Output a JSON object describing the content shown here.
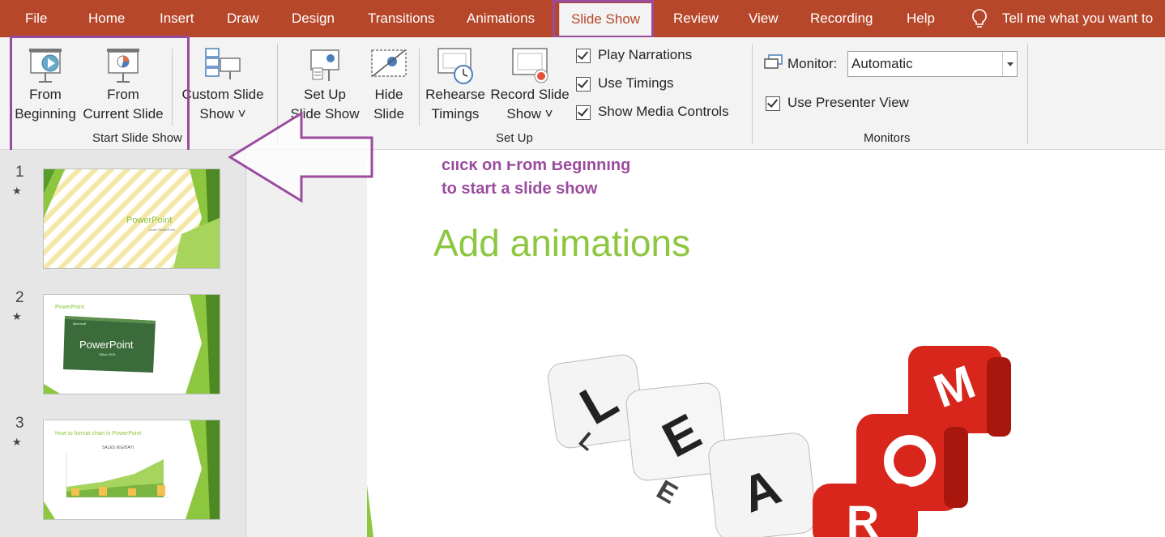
{
  "tabs": [
    "File",
    "Home",
    "Insert",
    "Draw",
    "Design",
    "Transitions",
    "Animations",
    "Slide Show",
    "Review",
    "View",
    "Recording",
    "Help"
  ],
  "tell_me": "Tell me what you want to",
  "ribbon": {
    "from_beginning": [
      "From",
      "Beginning"
    ],
    "from_current": [
      "From",
      "Current Slide"
    ],
    "custom_show": [
      "Custom Slide",
      "Show ˅"
    ],
    "start_group": "Start Slide Show",
    "setup_show": [
      "Set Up",
      "Slide Show"
    ],
    "hide_slide": [
      "Hide",
      "Slide"
    ],
    "rehearse": [
      "Rehearse",
      "Timings"
    ],
    "record": [
      "Record Slide",
      "Show ˅"
    ],
    "play_narrations": "Play Narrations",
    "use_timings": "Use Timings",
    "show_media": "Show Media Controls",
    "setup_group": "Set Up",
    "monitor_label": "Monitor:",
    "monitor_value": "Automatic",
    "presenter_view": "Use Presenter View",
    "monitors_group": "Monitors"
  },
  "slides": [
    {
      "num": "1",
      "thumb_title": "PowerPoint",
      "thumb_sub": "Learn PowerPoint"
    },
    {
      "num": "2",
      "thumb_title": "PowerPoint",
      "thumb_logo": "PowerPoint",
      "thumb_small": "Office 2019",
      "thumb_ms": "Microsoft"
    },
    {
      "num": "3",
      "thumb_title": "How to format chart in PowerPoint",
      "thumb_chart_title": "SALES (KG/DAY)"
    }
  ],
  "annotation": [
    "click on From Beginning",
    "to start a slide show"
  ],
  "slide_title": "Add animations",
  "colors": {
    "accent": "#b7472a",
    "annotation": "#9b4b9e",
    "green": "#8dc63f"
  }
}
